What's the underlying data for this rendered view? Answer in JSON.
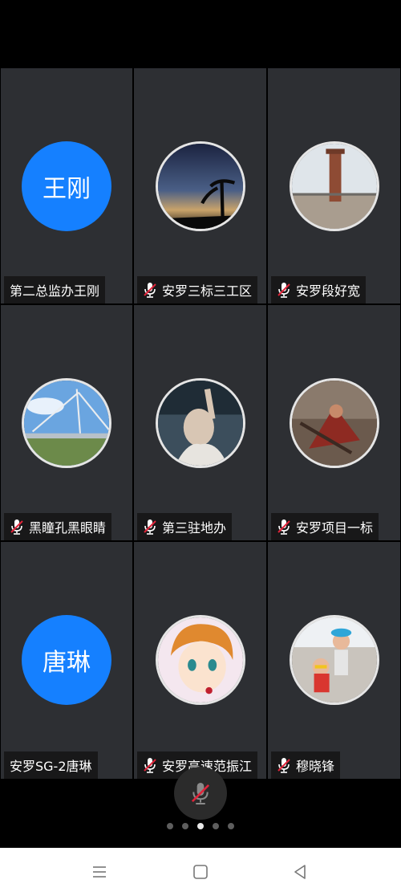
{
  "participants": [
    {
      "name": "第二总监办王刚",
      "avatar_text": "王刚",
      "muted": false
    },
    {
      "name": "安罗三标三工区",
      "avatar": "night-sky-photo",
      "muted": true
    },
    {
      "name": "安罗段好宽",
      "avatar": "monument-photo",
      "muted": true
    },
    {
      "name": "黑瞳孔黑眼睛",
      "avatar": "bridge-photo",
      "muted": true
    },
    {
      "name": "第三驻地办",
      "avatar": "person-photo",
      "muted": true
    },
    {
      "name": "安罗项目一标",
      "avatar": "warrior-art",
      "muted": true
    },
    {
      "name": "安罗SG-2唐琳",
      "avatar_text": "唐琳",
      "muted": false
    },
    {
      "name": "安罗高速范振江",
      "avatar": "anime-boy-art",
      "muted": true
    },
    {
      "name": "穆晓锋",
      "avatar": "child-photo",
      "muted": true
    }
  ],
  "colors": {
    "tile_bg": "#2d2f33",
    "avatar_blue": "#1580ff",
    "mute_red": "#e0243a"
  },
  "controls": {
    "mic_button": "mic-muted-icon"
  },
  "pagination": {
    "pages": 5,
    "active_page": 3
  },
  "navbar": {
    "items": [
      "menu-icon",
      "home-icon",
      "back-icon"
    ]
  }
}
